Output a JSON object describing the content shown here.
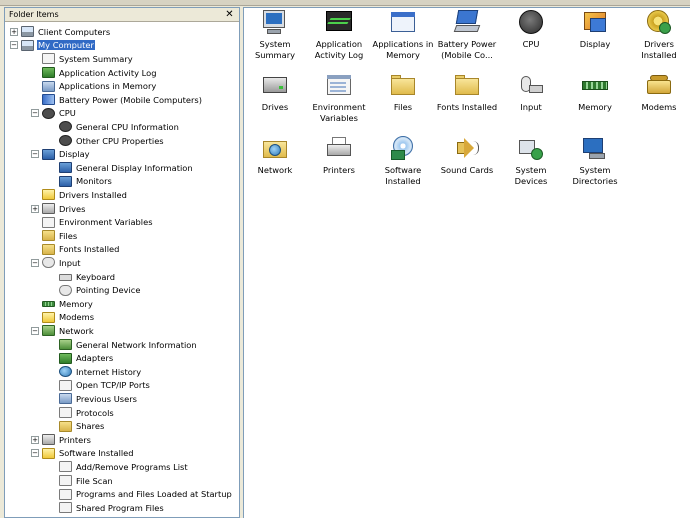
{
  "left_pane": {
    "title": "Folder Items",
    "close_glyph": "✕",
    "tree": [
      {
        "label": "Client Computers",
        "depth": 0,
        "expander": "+",
        "icon": "computers-icon",
        "icon_class": "ic-pc"
      },
      {
        "label": "My Computer",
        "depth": 0,
        "expander": "−",
        "icon": "computer-icon",
        "icon_class": "ic-pc",
        "selected": true
      },
      {
        "label": "System Summary",
        "depth": 1,
        "expander": "",
        "icon": "summary-icon",
        "icon_class": "ic-doc"
      },
      {
        "label": "Application Activity Log",
        "depth": 1,
        "expander": "",
        "icon": "log-icon",
        "icon_class": "ic-green"
      },
      {
        "label": "Applications in Memory",
        "depth": 1,
        "expander": "",
        "icon": "app-memory-icon",
        "icon_class": "ic-users"
      },
      {
        "label": "Battery Power (Mobile Computers)",
        "depth": 1,
        "expander": "",
        "icon": "battery-icon",
        "icon_class": "ic-battery"
      },
      {
        "label": "CPU",
        "depth": 1,
        "expander": "−",
        "icon": "cpu-icon",
        "icon_class": "ic-chip"
      },
      {
        "label": "General CPU Information",
        "depth": 2,
        "expander": "",
        "icon": "cpu-info-icon",
        "icon_class": "ic-chip"
      },
      {
        "label": "Other CPU Properties",
        "depth": 2,
        "expander": "",
        "icon": "cpu-properties-icon",
        "icon_class": "ic-chip"
      },
      {
        "label": "Display",
        "depth": 1,
        "expander": "−",
        "icon": "display-icon",
        "icon_class": "ic-display"
      },
      {
        "label": "General Display Information",
        "depth": 2,
        "expander": "",
        "icon": "display-info-icon",
        "icon_class": "ic-display"
      },
      {
        "label": "Monitors",
        "depth": 2,
        "expander": "",
        "icon": "monitor-icon",
        "icon_class": "ic-display"
      },
      {
        "label": "Drivers Installed",
        "depth": 1,
        "expander": "",
        "icon": "drivers-icon",
        "icon_class": "ic-yellow"
      },
      {
        "label": "Drives",
        "depth": 1,
        "expander": "+",
        "icon": "drives-icon",
        "icon_class": "ic-printer"
      },
      {
        "label": "Environment Variables",
        "depth": 1,
        "expander": "",
        "icon": "env-vars-icon",
        "icon_class": "ic-doc"
      },
      {
        "label": "Files",
        "depth": 1,
        "expander": "",
        "icon": "files-icon",
        "icon_class": "ic-folder"
      },
      {
        "label": "Fonts Installed",
        "depth": 1,
        "expander": "",
        "icon": "fonts-icon",
        "icon_class": "ic-folder"
      },
      {
        "label": "Input",
        "depth": 1,
        "expander": "−",
        "icon": "input-icon",
        "icon_class": "ic-mouse"
      },
      {
        "label": "Keyboard",
        "depth": 2,
        "expander": "",
        "icon": "keyboard-icon",
        "icon_class": "ic-keyboard"
      },
      {
        "label": "Pointing Device",
        "depth": 2,
        "expander": "",
        "icon": "mouse-icon",
        "icon_class": "ic-mouse"
      },
      {
        "label": "Memory",
        "depth": 1,
        "expander": "",
        "icon": "memory-icon",
        "icon_class": "ic-memory"
      },
      {
        "label": "Modems",
        "depth": 1,
        "expander": "",
        "icon": "modem-icon",
        "icon_class": "ic-yellow"
      },
      {
        "label": "Network",
        "depth": 1,
        "expander": "−",
        "icon": "network-icon",
        "icon_class": "ic-net"
      },
      {
        "label": "General Network Information",
        "depth": 2,
        "expander": "",
        "icon": "network-info-icon",
        "icon_class": "ic-net"
      },
      {
        "label": "Adapters",
        "depth": 2,
        "expander": "",
        "icon": "adapter-icon",
        "icon_class": "ic-green"
      },
      {
        "label": "Internet History",
        "depth": 2,
        "expander": "",
        "icon": "history-icon",
        "icon_class": "ic-globe"
      },
      {
        "label": "Open TCP/IP Ports",
        "depth": 2,
        "expander": "",
        "icon": "ports-icon",
        "icon_class": "ic-doc"
      },
      {
        "label": "Previous Users",
        "depth": 2,
        "expander": "",
        "icon": "users-icon",
        "icon_class": "ic-users"
      },
      {
        "label": "Protocols",
        "depth": 2,
        "expander": "",
        "icon": "protocols-icon",
        "icon_class": "ic-doc"
      },
      {
        "label": "Shares",
        "depth": 2,
        "expander": "",
        "icon": "shares-icon",
        "icon_class": "ic-folder"
      },
      {
        "label": "Printers",
        "depth": 1,
        "expander": "+",
        "icon": "printer-icon",
        "icon_class": "ic-printer"
      },
      {
        "label": "Software Installed",
        "depth": 1,
        "expander": "−",
        "icon": "software-icon",
        "icon_class": "ic-yellow"
      },
      {
        "label": "Add/Remove Programs List",
        "depth": 2,
        "expander": "",
        "icon": "add-remove-icon",
        "icon_class": "ic-doc"
      },
      {
        "label": "File Scan",
        "depth": 2,
        "expander": "",
        "icon": "file-scan-icon",
        "icon_class": "ic-doc"
      },
      {
        "label": "Programs and Files Loaded at Startup",
        "depth": 2,
        "expander": "",
        "icon": "startup-icon",
        "icon_class": "ic-doc"
      },
      {
        "label": "Shared Program Files",
        "depth": 2,
        "expander": "",
        "icon": "shared-files-icon",
        "icon_class": "ic-doc"
      }
    ]
  },
  "right_pane": {
    "items": [
      {
        "label": "System Summary",
        "art": "bi-pc",
        "icon": "system-summary-icon"
      },
      {
        "label": "Application Activity Log",
        "art": "bi-log",
        "icon": "activity-log-icon"
      },
      {
        "label": "Applications in Memory",
        "art": "bi-appmem",
        "icon": "applications-memory-icon"
      },
      {
        "label": "Battery Power (Mobile Co...",
        "art": "bi-laptop",
        "icon": "battery-power-icon"
      },
      {
        "label": "CPU",
        "art": "bi-cpu",
        "icon": "cpu-icon"
      },
      {
        "label": "Display",
        "art": "bi-display",
        "icon": "display-icon"
      },
      {
        "label": "Drivers Installed",
        "art": "bi-drivers",
        "icon": "drivers-icon"
      },
      {
        "label": "Drives",
        "art": "bi-drives",
        "icon": "drives-icon"
      },
      {
        "label": "Environment Variables",
        "art": "bi-env",
        "icon": "environment-variables-icon"
      },
      {
        "label": "Files",
        "art": "bi-folder",
        "icon": "files-folder-icon"
      },
      {
        "label": "Fonts Installed",
        "art": "bi-folder",
        "icon": "fonts-folder-icon"
      },
      {
        "label": "Input",
        "art": "bi-input",
        "icon": "input-icon"
      },
      {
        "label": "Memory",
        "art": "bi-memory",
        "icon": "memory-icon"
      },
      {
        "label": "Modems",
        "art": "bi-modem",
        "icon": "modem-icon"
      },
      {
        "label": "Network",
        "art": "bi-network",
        "icon": "network-folder-icon"
      },
      {
        "label": "Printers",
        "art": "bi-printer",
        "icon": "printer-icon"
      },
      {
        "label": "Software Installed",
        "art": "bi-sw",
        "icon": "software-installed-icon"
      },
      {
        "label": "Sound Cards",
        "art": "bi-sound",
        "icon": "sound-card-icon"
      },
      {
        "label": "System Devices",
        "art": "bi-devices",
        "icon": "system-devices-icon"
      },
      {
        "label": "System Directories",
        "art": "bi-dirs",
        "icon": "system-directories-icon"
      }
    ]
  }
}
